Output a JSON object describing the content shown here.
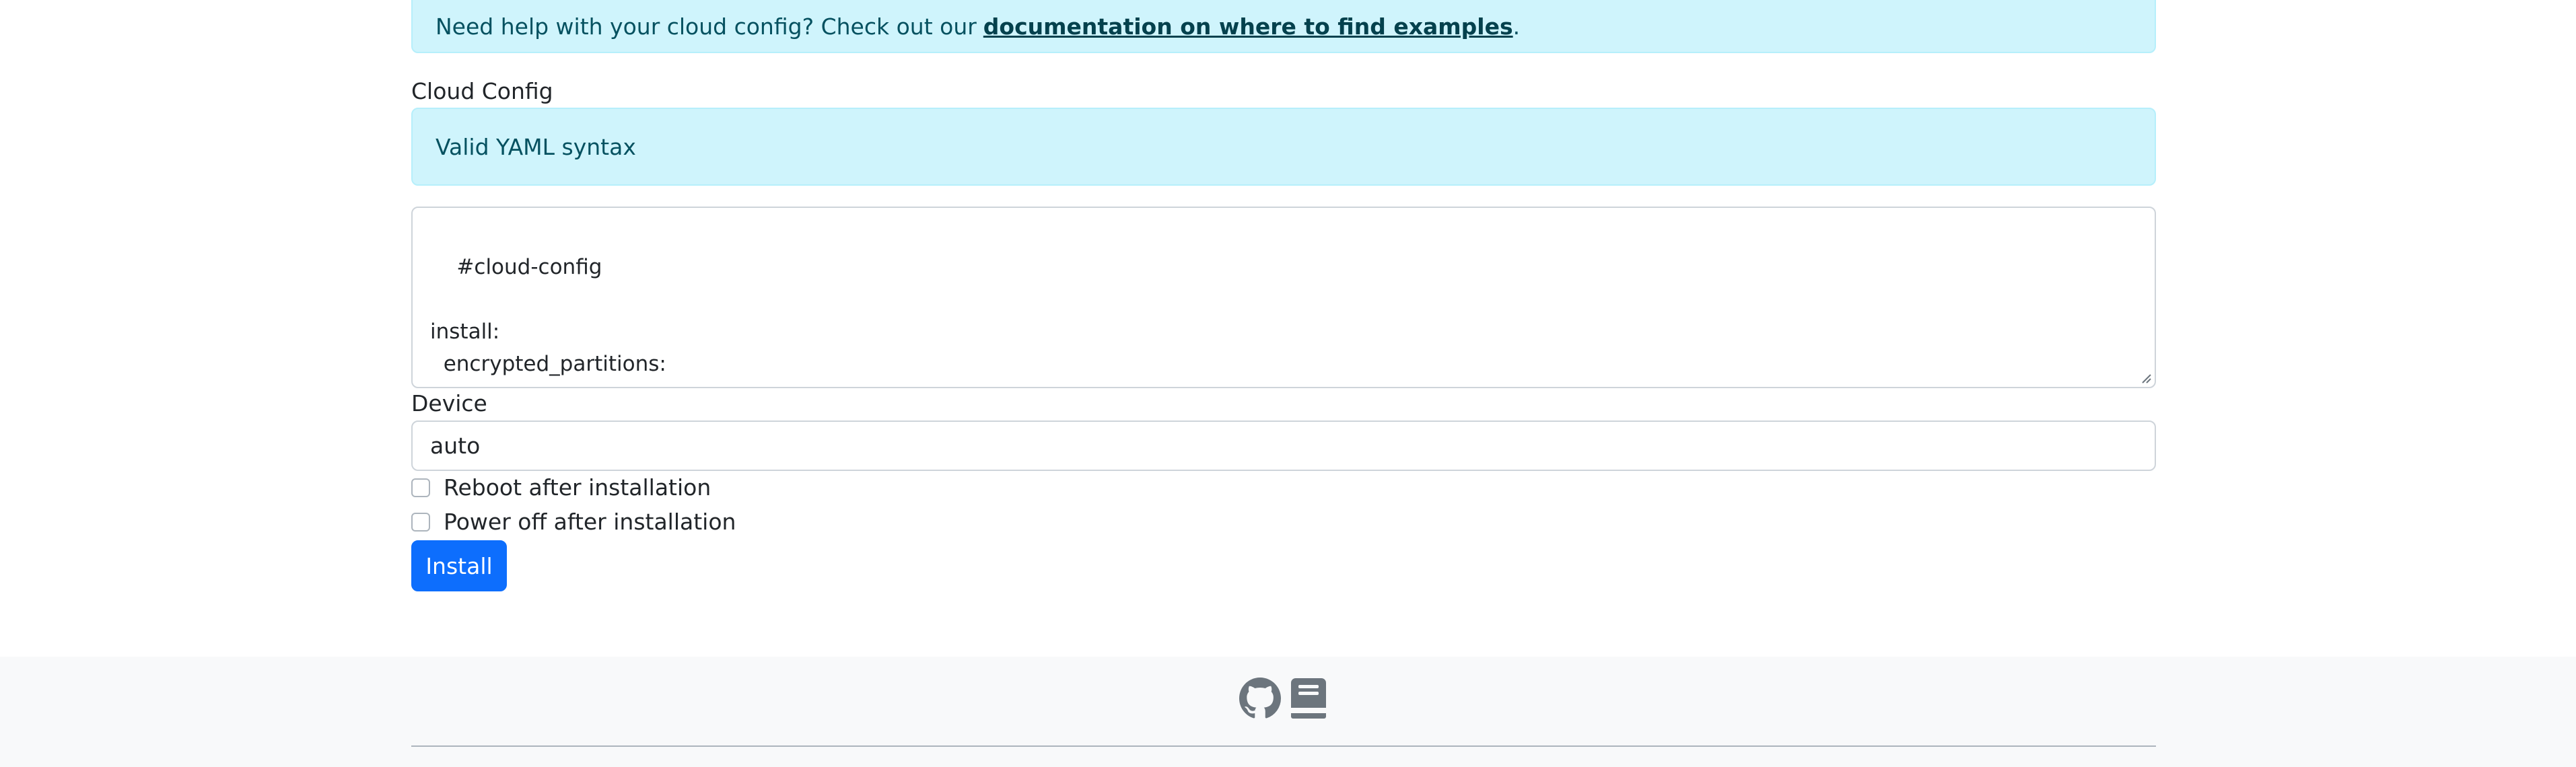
{
  "help_alert": {
    "text": "Need help with your cloud config? Check out our",
    "link_text": "documentation on where to find examples",
    "suffix": "."
  },
  "cloud_config": {
    "label": "Cloud Config",
    "validation_message": "Valid YAML syntax",
    "value": "#cloud-config\n\ninstall:\n  encrypted_partitions:\n  - COS_PERSISTENT"
  },
  "device": {
    "label": "Device",
    "value": "auto"
  },
  "options": {
    "reboot_label": "Reboot after installation",
    "reboot_checked": false,
    "poweroff_label": "Power off after installation",
    "poweroff_checked": false
  },
  "install_button": {
    "label": "Install"
  },
  "footer": {
    "icons": [
      "github-icon",
      "book-icon"
    ]
  },
  "colors": {
    "info_bg": "#cff4fc",
    "info_text": "#055160",
    "primary": "#0d6efd",
    "footer_bg": "#f8f9fa"
  }
}
